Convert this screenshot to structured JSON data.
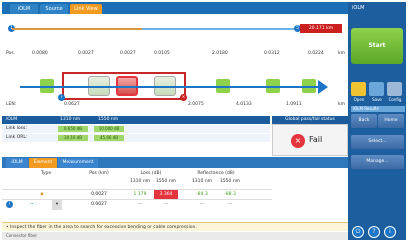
{
  "tabs": [
    {
      "label": "iOLM"
    },
    {
      "label": "Source"
    },
    {
      "label": "Link View"
    }
  ],
  "link_view": {
    "distance_badge": "20.171 km",
    "pos_label": "Pos.",
    "km_unit_top": "km",
    "km_unit_bottom": "km",
    "top_positions": [
      "0.0080",
      "0.0027",
      "0.0027",
      "0.0105",
      "2.0180",
      "0.0312",
      "0.0224"
    ],
    "bottom_positions": [
      "0.0627",
      "2.0075",
      "4.0133",
      "1.0911"
    ],
    "left_label": "LEN:",
    "circle_left": "1",
    "circle_right": "5"
  },
  "summary": {
    "header_col1": "iOLM",
    "header_wl1": "1310 nm",
    "header_wl2": "1550 nm",
    "rows": [
      {
        "label": "Link loss:",
        "v1": "0.650 dB",
        "v2": "10.000 dB"
      },
      {
        "label": "Link ORL:",
        "v1": "34.16 dB",
        "v2": "45.66 dB"
      }
    ],
    "gp_header": "Global pass/fail status",
    "fail_text": "Fail",
    "fail_icon": "x-icon"
  },
  "lower_tabs": [
    {
      "label": "iOLM"
    },
    {
      "label": "Element"
    },
    {
      "label": "Measurement Info"
    }
  ],
  "element_table": {
    "headers": {
      "type": "Type",
      "pos": "Pos (km)",
      "loss": "Loss (dB)",
      "refl": "Reflectance (dB)",
      "loss_1310": "1310 nm",
      "loss_1550": "1550 nm",
      "refl_1310": "1310 nm",
      "refl_1550": "1550 nm"
    },
    "rows": [
      {
        "pos": "0.0027",
        "loss1": "1.179",
        "loss2": "3.364",
        "refl1": "-84.3",
        "refl2": "-88.3"
      },
      {
        "pos": "0.0027",
        "loss1": "---",
        "loss2": "---",
        "refl1": "---",
        "refl2": "---"
      }
    ]
  },
  "status_text": "• Inspect the fiber in the area to search for excessive bending or cable compression.",
  "footer_text": "Connector fiber",
  "right_panel": {
    "title": "iOLM",
    "start_label": "Start",
    "tools": [
      {
        "label": "Open"
      },
      {
        "label": "Save"
      },
      {
        "label": "Config"
      }
    ],
    "section_label": "iOLM Results",
    "buttons": [
      {
        "label": "Back"
      },
      {
        "label": "Home"
      },
      {
        "label": "Select..."
      },
      {
        "label": "Manage..."
      }
    ]
  },
  "colors": {
    "accent": "#f39a21",
    "primary": "#1c6fb4",
    "fail": "#e4343d",
    "pass": "#8ed24c"
  }
}
